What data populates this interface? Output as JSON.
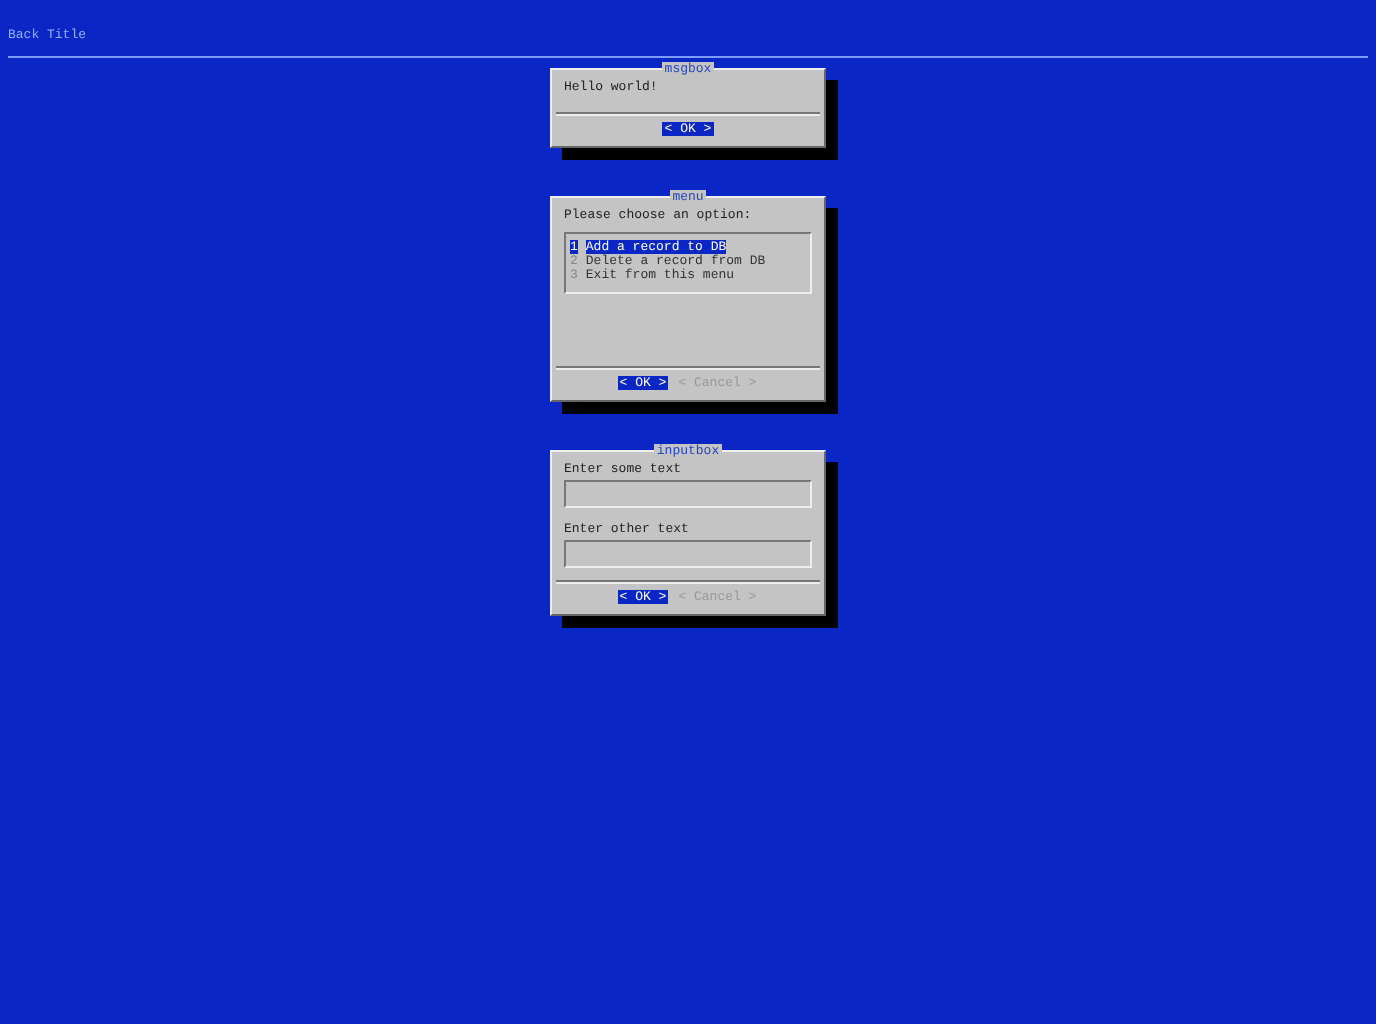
{
  "back_title": "Back Title",
  "dialogs": [
    {
      "kind": "msgbox",
      "title": "msgbox",
      "text": "Hello world!",
      "buttons": [
        {
          "label": "< OK >",
          "selected": true
        }
      ]
    },
    {
      "kind": "menu",
      "title": "menu",
      "prompt": "Please choose an option:",
      "items": [
        {
          "tag": "1",
          "label": "Add a record to DB",
          "selected": true
        },
        {
          "tag": "2",
          "label": "Delete a record from DB",
          "selected": false
        },
        {
          "tag": "3",
          "label": "Exit from this menu",
          "selected": false
        }
      ],
      "buttons": [
        {
          "label": "< OK >",
          "selected": true
        },
        {
          "label": "< Cancel >",
          "selected": false
        }
      ]
    },
    {
      "kind": "inputbox",
      "title": "inputbox",
      "fields": [
        {
          "label": "Enter some text"
        },
        {
          "label": "Enter other text"
        }
      ],
      "buttons": [
        {
          "label": "< OK >",
          "selected": true
        },
        {
          "label": "< Cancel >",
          "selected": false
        }
      ]
    }
  ]
}
